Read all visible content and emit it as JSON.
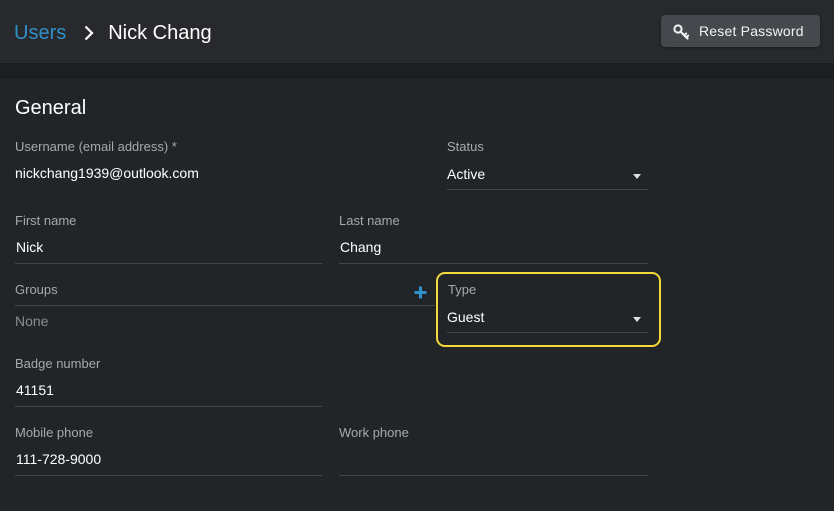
{
  "header": {
    "breadcrumb": {
      "parent": "Users",
      "current": "Nick Chang"
    },
    "reset_password_label": "Reset Password"
  },
  "section": {
    "title": "General"
  },
  "fields": {
    "username": {
      "label": "Username (email address) *",
      "value": "nickchang1939@outlook.com"
    },
    "status": {
      "label": "Status",
      "value": "Active"
    },
    "first_name": {
      "label": "First name",
      "value": "Nick"
    },
    "last_name": {
      "label": "Last name",
      "value": "Chang"
    },
    "groups": {
      "label": "Groups",
      "value": "None"
    },
    "type": {
      "label": "Type",
      "value": "Guest"
    },
    "badge_number": {
      "label": "Badge number",
      "value": "41151"
    },
    "mobile_phone": {
      "label": "Mobile phone",
      "value": "111-728-9000"
    },
    "work_phone": {
      "label": "Work phone",
      "value": ""
    }
  },
  "colors": {
    "link": "#2f8fc9",
    "highlight": "#f2d83a",
    "background": "#222528"
  }
}
